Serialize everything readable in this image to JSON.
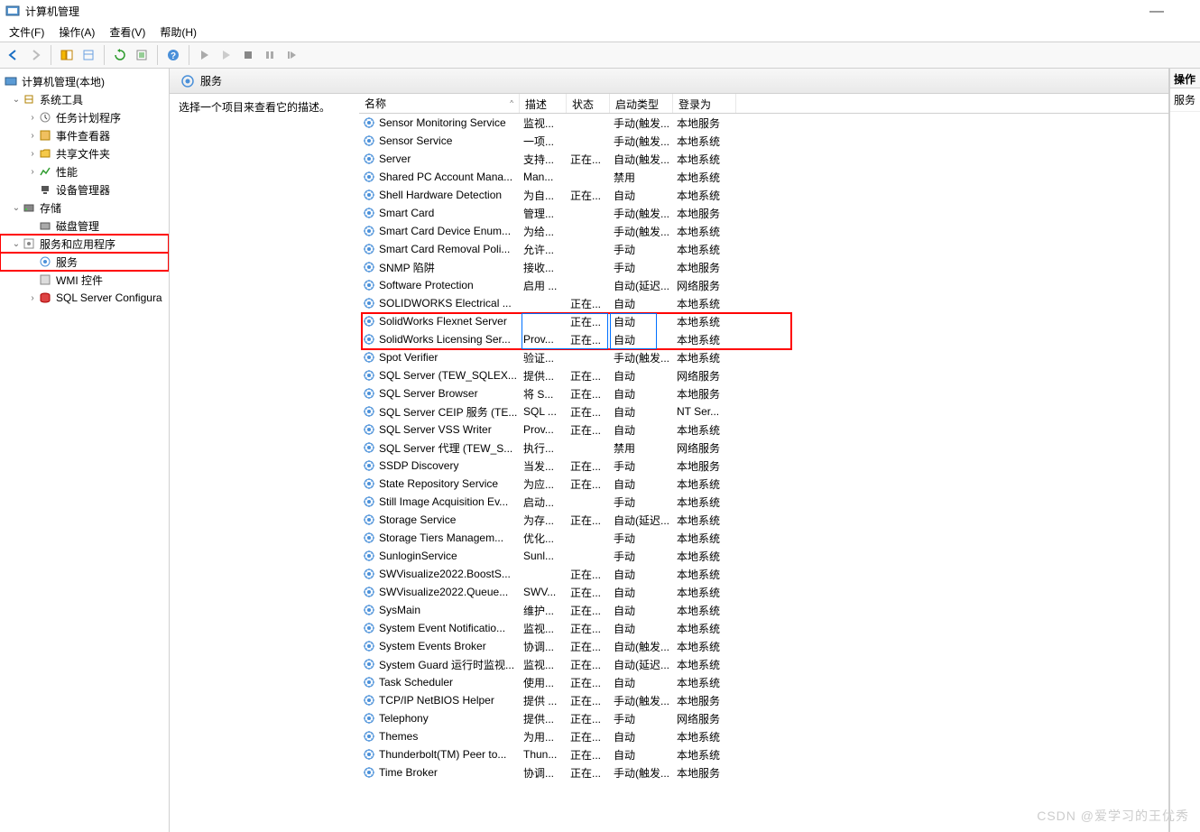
{
  "window": {
    "title": "计算机管理"
  },
  "menu": {
    "file": "文件(F)",
    "action": "操作(A)",
    "view": "查看(V)",
    "help": "帮助(H)"
  },
  "tree": {
    "root": "计算机管理(本地)",
    "systools": "系统工具",
    "scheduler": "任务计划程序",
    "eventviewer": "事件查看器",
    "sharedfolders": "共享文件夹",
    "perf": "性能",
    "devicemgr": "设备管理器",
    "storage": "存储",
    "diskmgr": "磁盘管理",
    "servicesapps": "服务和应用程序",
    "services": "服务",
    "wmi": "WMI 控件",
    "sqlconfig": "SQL Server Configura"
  },
  "panel": {
    "header": "服务",
    "hint": "选择一个项目来查看它的描述。",
    "cols": {
      "name": "名称",
      "desc": "描述",
      "status": "状态",
      "start": "启动类型",
      "logon": "登录为"
    }
  },
  "actions": {
    "title": "操作",
    "svc": "服务"
  },
  "watermark": "CSDN @爱学习的王优秀",
  "services": [
    {
      "n": "Sensor Monitoring Service",
      "d": "监视...",
      "s": "",
      "t": "手动(触发...",
      "l": "本地服务"
    },
    {
      "n": "Sensor Service",
      "d": "一项...",
      "s": "",
      "t": "手动(触发...",
      "l": "本地系统"
    },
    {
      "n": "Server",
      "d": "支持...",
      "s": "正在...",
      "t": "自动(触发...",
      "l": "本地系统"
    },
    {
      "n": "Shared PC Account Mana...",
      "d": "Man...",
      "s": "",
      "t": "禁用",
      "l": "本地系统"
    },
    {
      "n": "Shell Hardware Detection",
      "d": "为自...",
      "s": "正在...",
      "t": "自动",
      "l": "本地系统"
    },
    {
      "n": "Smart Card",
      "d": "管理...",
      "s": "",
      "t": "手动(触发...",
      "l": "本地服务"
    },
    {
      "n": "Smart Card Device Enum...",
      "d": "为给...",
      "s": "",
      "t": "手动(触发...",
      "l": "本地系统"
    },
    {
      "n": "Smart Card Removal Poli...",
      "d": "允许...",
      "s": "",
      "t": "手动",
      "l": "本地系统"
    },
    {
      "n": "SNMP 陷阱",
      "d": "接收...",
      "s": "",
      "t": "手动",
      "l": "本地服务"
    },
    {
      "n": "Software Protection",
      "d": "启用 ...",
      "s": "",
      "t": "自动(延迟...",
      "l": "网络服务"
    },
    {
      "n": "SOLIDWORKS Electrical ...",
      "d": "",
      "s": "正在...",
      "t": "自动",
      "l": "本地系统"
    },
    {
      "n": "SolidWorks Flexnet Server",
      "d": "",
      "s": "正在...",
      "t": "自动",
      "l": "本地系统"
    },
    {
      "n": "SolidWorks Licensing Ser...",
      "d": "Prov...",
      "s": "正在...",
      "t": "自动",
      "l": "本地系统"
    },
    {
      "n": "Spot Verifier",
      "d": "验证...",
      "s": "",
      "t": "手动(触发...",
      "l": "本地系统"
    },
    {
      "n": "SQL Server (TEW_SQLEX...",
      "d": "提供...",
      "s": "正在...",
      "t": "自动",
      "l": "网络服务"
    },
    {
      "n": "SQL Server Browser",
      "d": "将 S...",
      "s": "正在...",
      "t": "自动",
      "l": "本地服务"
    },
    {
      "n": "SQL Server CEIP 服务 (TE...",
      "d": "SQL ...",
      "s": "正在...",
      "t": "自动",
      "l": "NT Ser..."
    },
    {
      "n": "SQL Server VSS Writer",
      "d": "Prov...",
      "s": "正在...",
      "t": "自动",
      "l": "本地系统"
    },
    {
      "n": "SQL Server 代理 (TEW_S...",
      "d": "执行...",
      "s": "",
      "t": "禁用",
      "l": "网络服务"
    },
    {
      "n": "SSDP Discovery",
      "d": "当发...",
      "s": "正在...",
      "t": "手动",
      "l": "本地服务"
    },
    {
      "n": "State Repository Service",
      "d": "为应...",
      "s": "正在...",
      "t": "自动",
      "l": "本地系统"
    },
    {
      "n": "Still Image Acquisition Ev...",
      "d": "启动...",
      "s": "",
      "t": "手动",
      "l": "本地系统"
    },
    {
      "n": "Storage Service",
      "d": "为存...",
      "s": "正在...",
      "t": "自动(延迟...",
      "l": "本地系统"
    },
    {
      "n": "Storage Tiers Managem...",
      "d": "优化...",
      "s": "",
      "t": "手动",
      "l": "本地系统"
    },
    {
      "n": "SunloginService",
      "d": "Sunl...",
      "s": "",
      "t": "手动",
      "l": "本地系统"
    },
    {
      "n": "SWVisualize2022.BoostS...",
      "d": "",
      "s": "正在...",
      "t": "自动",
      "l": "本地系统"
    },
    {
      "n": "SWVisualize2022.Queue...",
      "d": "SWV...",
      "s": "正在...",
      "t": "自动",
      "l": "本地系统"
    },
    {
      "n": "SysMain",
      "d": "维护...",
      "s": "正在...",
      "t": "自动",
      "l": "本地系统"
    },
    {
      "n": "System Event Notificatio...",
      "d": "监视...",
      "s": "正在...",
      "t": "自动",
      "l": "本地系统"
    },
    {
      "n": "System Events Broker",
      "d": "协调...",
      "s": "正在...",
      "t": "自动(触发...",
      "l": "本地系统"
    },
    {
      "n": "System Guard 运行时监视...",
      "d": "监视...",
      "s": "正在...",
      "t": "自动(延迟...",
      "l": "本地系统"
    },
    {
      "n": "Task Scheduler",
      "d": "使用...",
      "s": "正在...",
      "t": "自动",
      "l": "本地系统"
    },
    {
      "n": "TCP/IP NetBIOS Helper",
      "d": "提供 ...",
      "s": "正在...",
      "t": "手动(触发...",
      "l": "本地服务"
    },
    {
      "n": "Telephony",
      "d": "提供...",
      "s": "正在...",
      "t": "手动",
      "l": "网络服务"
    },
    {
      "n": "Themes",
      "d": "为用...",
      "s": "正在...",
      "t": "自动",
      "l": "本地系统"
    },
    {
      "n": "Thunderbolt(TM) Peer to...",
      "d": "Thun...",
      "s": "正在...",
      "t": "自动",
      "l": "本地系统"
    },
    {
      "n": "Time Broker",
      "d": "协调...",
      "s": "正在...",
      "t": "手动(触发...",
      "l": "本地服务"
    }
  ]
}
